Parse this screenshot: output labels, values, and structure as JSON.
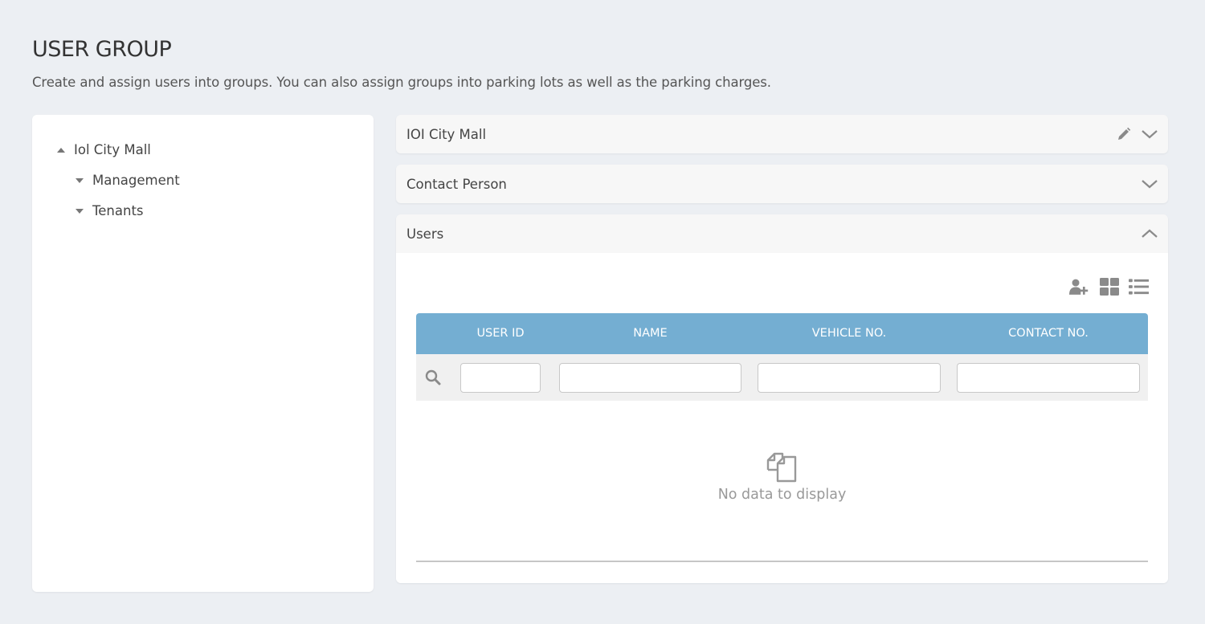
{
  "header": {
    "title": "USER GROUP",
    "subtitle": "Create and assign users into groups. You can also assign groups into parking lots as well as the parking charges."
  },
  "tree": {
    "root": {
      "label": "Iol City Mall",
      "expanded": true
    },
    "children": [
      {
        "label": "Management",
        "expanded": false
      },
      {
        "label": "Tenants",
        "expanded": false
      }
    ]
  },
  "panels": {
    "group": {
      "title": "IOI City Mall",
      "icons": [
        "pencil-icon",
        "chevron-down-icon"
      ]
    },
    "contact": {
      "title": "Contact Person",
      "icons": [
        "chevron-down-icon"
      ]
    },
    "users": {
      "title": "Users",
      "icons": [
        "chevron-up-icon"
      ],
      "toolbar": [
        "add-user-icon",
        "grid-view-icon",
        "list-view-icon"
      ],
      "columns": [
        "USER ID",
        "NAME",
        "VEHICLE NO.",
        "CONTACT NO."
      ],
      "filters": {
        "user_id": "",
        "name": "",
        "vehicle_no": "",
        "contact_no": ""
      },
      "empty_text": "No data to display"
    }
  },
  "colors": {
    "background": "#eceff3",
    "grid_header": "#74aed2",
    "icon_gray": "#8a8a8a"
  }
}
